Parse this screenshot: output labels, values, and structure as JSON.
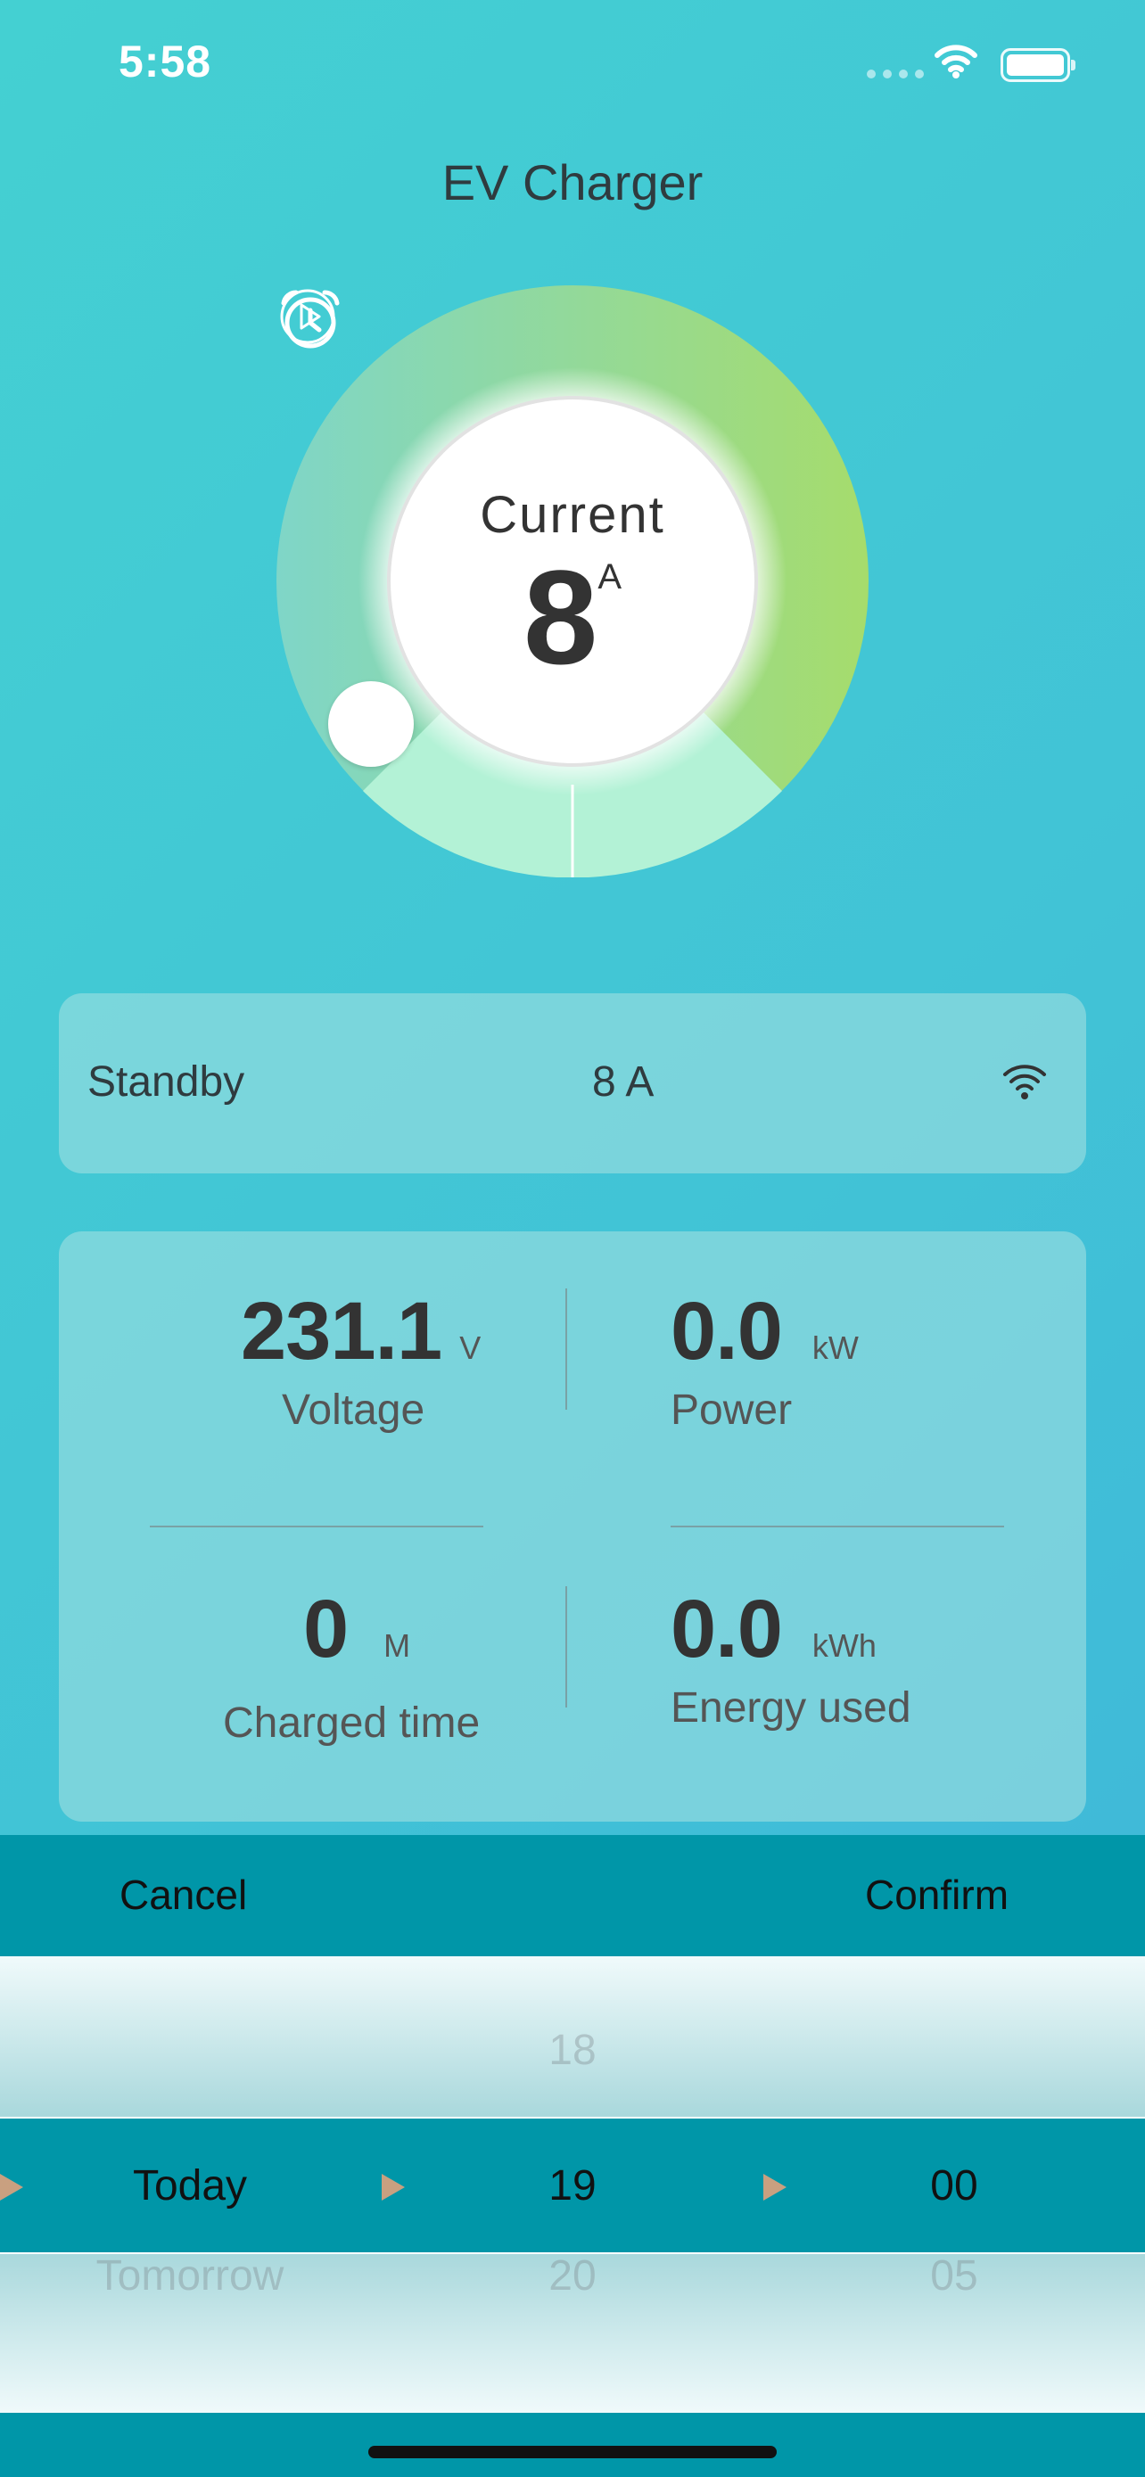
{
  "status_bar": {
    "time": "5:58"
  },
  "app": {
    "title": "EV Charger"
  },
  "dial": {
    "label": "Current",
    "value": "8",
    "unit": "A"
  },
  "status": {
    "state": "Standby",
    "current": "8 A"
  },
  "metrics": [
    {
      "value": "231.1",
      "unit": "V",
      "label": "Voltage"
    },
    {
      "value": "0.0",
      "unit": "kW",
      "label": "Power"
    },
    {
      "value": "0",
      "unit": "M",
      "label": "Charged time"
    },
    {
      "value": "0.0",
      "unit": "kWh",
      "label": "Energy used"
    }
  ],
  "picker": {
    "cancel_label": "Cancel",
    "confirm_label": "Confirm",
    "day_column": {
      "above": "",
      "selected": "Today",
      "below": "Tomorrow"
    },
    "hour_column": {
      "above": "18",
      "selected": "19",
      "below": "20"
    },
    "minute_column": {
      "above": "",
      "selected": "00",
      "below": "05"
    }
  },
  "colors": {
    "background_gradient": [
      "#44d0d2",
      "#3fb4da"
    ],
    "accent_teal": "#0096a8",
    "dial_gradient": [
      "#7fd6c8",
      "#a6dc6c"
    ],
    "dial_lower_segment": "#b3f2d6",
    "arrow": "#c9a080"
  },
  "icons": [
    "wifi-icon",
    "battery-icon",
    "play-icon",
    "alarm-clock-icon",
    "wifi-signal-icon",
    "arrow-right-icon"
  ]
}
